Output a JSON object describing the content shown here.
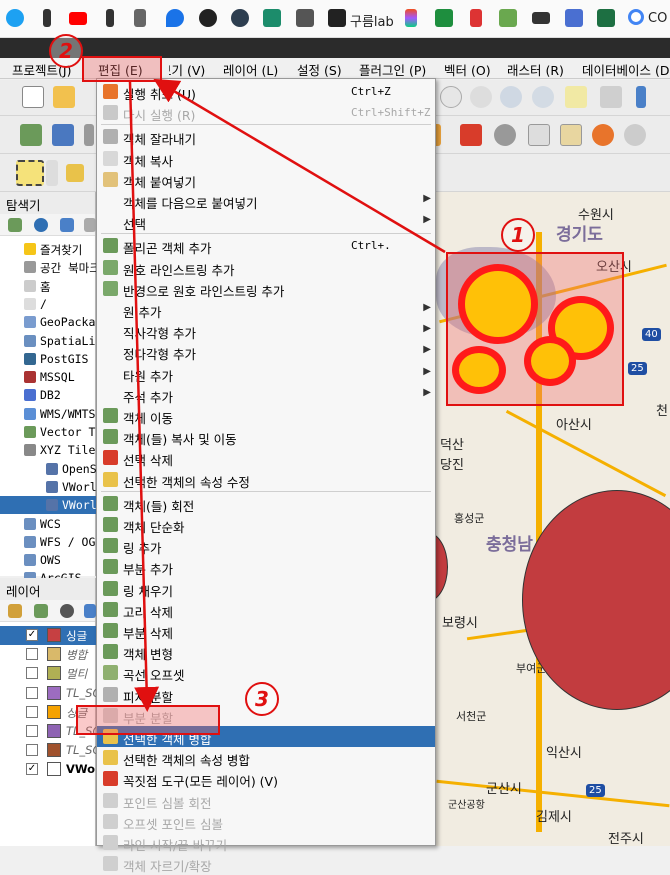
{
  "bookmarks": {
    "label": "구름lab",
    "last": "CO"
  },
  "menubar": [
    {
      "label": "프로젝트(J)"
    },
    {
      "label": "편집 (E)"
    },
    {
      "label": "보기 (V)"
    },
    {
      "label": "레이어 (L)"
    },
    {
      "label": "설정 (S)"
    },
    {
      "label": "플러그인 (P)"
    },
    {
      "label": "벡터 (O)"
    },
    {
      "label": "래스터 (R)"
    },
    {
      "label": "데이터베이스 (D"
    }
  ],
  "browser": {
    "title": "탐색기",
    "items": [
      "즐겨찾기",
      "공간 북마크",
      "홈",
      "/",
      "GeoPackage",
      "SpatiaLite",
      "PostGIS",
      "MSSQL",
      "DB2",
      "WMS/WMTS",
      "Vector Tiles",
      "XYZ Tiles",
      "OpenStreetMap",
      "VWorld",
      "VWorld",
      "WCS",
      "WFS / OGC",
      "OWS",
      "ArcGIS"
    ]
  },
  "layers": {
    "title": "레이어",
    "items": [
      {
        "label": "싱글",
        "checked": true,
        "color": "#c64042",
        "selected": true
      },
      {
        "label": "병합",
        "checked": false,
        "color": "#d9b96a"
      },
      {
        "label": "멀티",
        "checked": false,
        "color": "#b0b054"
      },
      {
        "label": "TL_SC",
        "checked": false,
        "color": "#9c6cc0"
      },
      {
        "label": "싱글",
        "checked": false,
        "color": "#f5a200"
      },
      {
        "label": "TL_SC",
        "checked": false,
        "color": "#8e63b3"
      },
      {
        "label": "TL_SC",
        "checked": false,
        "color": "#a0522d"
      },
      {
        "label": "VWorld",
        "checked": true,
        "color": "#ffffff"
      }
    ]
  },
  "edit_menu": [
    {
      "label": "실행 취소 (U)",
      "shortcut": "Ctrl+Z",
      "icon": "undo-icon",
      "color": "#e8742b"
    },
    {
      "label": "다시 실행 (R)",
      "shortcut": "Ctrl+Shift+Z",
      "icon": "redo-icon",
      "disabled": true,
      "color": "#c9c9c9"
    },
    {
      "sep": true
    },
    {
      "label": "객체 잘라내기",
      "icon": "cut-icon",
      "color": "#b0b0b0"
    },
    {
      "label": "객체 복사",
      "icon": "copy-icon",
      "color": "#d8d8d8"
    },
    {
      "label": "객체 붙여넣기",
      "icon": "paste-icon",
      "color": "#e2c27a"
    },
    {
      "label": "객체를 다음으로 붙여넣기",
      "submenu": true
    },
    {
      "label": "선택",
      "submenu": true
    },
    {
      "sep": true
    },
    {
      "label": "폴리곤 객체 추가",
      "shortcut": "Ctrl+.",
      "icon": "add-polygon-icon",
      "color": "#6b9a5a"
    },
    {
      "label": "원호 라인스트링 추가",
      "icon": "add-arc-icon",
      "color": "#7aa86a"
    },
    {
      "label": "반경으로 원호 라인스트링 추가",
      "icon": "add-arc-radius-icon",
      "color": "#7aa86a"
    },
    {
      "label": "원 추가",
      "submenu": true
    },
    {
      "label": "직사각형 추가",
      "submenu": true
    },
    {
      "label": "정다각형 추가",
      "submenu": true
    },
    {
      "label": "타원 추가",
      "submenu": true
    },
    {
      "label": "주석 추가",
      "submenu": true
    },
    {
      "label": "객체 이동",
      "icon": "move-feature-icon",
      "color": "#6b9a5a"
    },
    {
      "label": "객체(들) 복사 및 이동",
      "icon": "copy-move-icon",
      "color": "#6b9a5a"
    },
    {
      "label": "선택 삭제",
      "icon": "delete-icon",
      "color": "#d83c2a"
    },
    {
      "label": "선택한 객체의 속성 수정",
      "icon": "edit-attributes-icon",
      "color": "#e9c24a"
    },
    {
      "sep": true
    },
    {
      "label": "객체(들) 회전",
      "icon": "rotate-icon",
      "color": "#6b9a5a"
    },
    {
      "label": "객체 단순화",
      "icon": "simplify-icon",
      "color": "#6b9a5a"
    },
    {
      "label": "링 추가",
      "icon": "add-ring-icon",
      "color": "#6b9a5a"
    },
    {
      "label": "부분 추가",
      "icon": "add-part-icon",
      "color": "#6b9a5a"
    },
    {
      "label": "링 채우기",
      "icon": "fill-ring-icon",
      "color": "#6b9a5a"
    },
    {
      "label": "고리 삭제",
      "icon": "delete-ring-icon",
      "color": "#6b9a5a"
    },
    {
      "label": "부분 삭제",
      "icon": "delete-part-icon",
      "color": "#6b9a5a"
    },
    {
      "label": "객체 변형",
      "icon": "reshape-icon",
      "color": "#6b9a5a"
    },
    {
      "label": "곡선 오프셋",
      "icon": "offset-curve-icon",
      "color": "#8fb070"
    },
    {
      "label": "피처 분할",
      "icon": "split-features-icon",
      "color": "#b0b0b0"
    },
    {
      "label": "부분 분할",
      "icon": "split-parts-icon",
      "disabled": true,
      "color": "#cfcfcf"
    },
    {
      "label": "선택한 객체 병합",
      "icon": "merge-features-icon",
      "highlight": true,
      "color": "#e9c24a"
    },
    {
      "label": "선택한 객체의 속성 병합",
      "icon": "merge-attributes-icon",
      "color": "#e9c24a"
    },
    {
      "label": "꼭짓점 도구(모든 레이어) (V)",
      "icon": "vertex-tool-icon",
      "color": "#d83c2a"
    },
    {
      "label": "포인트 심볼 회전",
      "icon": "rotate-symbol-icon",
      "disabled": true,
      "color": "#cfcfcf"
    },
    {
      "label": "오프셋 포인트 심볼",
      "icon": "offset-symbol-icon",
      "disabled": true,
      "color": "#cfcfcf"
    },
    {
      "label": "라인 시작/끝 바꾸기",
      "icon": "reverse-line-icon",
      "disabled": true,
      "color": "#cfcfcf"
    },
    {
      "label": "객체 자르기/확장",
      "icon": "trim-extend-icon",
      "disabled": true,
      "color": "#cfcfcf"
    }
  ],
  "map": {
    "places": [
      "수원시",
      "경기도",
      "오산시",
      "아산시",
      "천",
      "덕산",
      "당진",
      "홍성군",
      "충청남",
      "보령시",
      "부여군",
      "서천군",
      "익산시",
      "군산시",
      "군산공항",
      "김제시",
      "전주시"
    ],
    "route_numbers": [
      "40",
      "25",
      "25"
    ]
  },
  "annotations": {
    "one": "1",
    "two": "2",
    "three": "3"
  }
}
